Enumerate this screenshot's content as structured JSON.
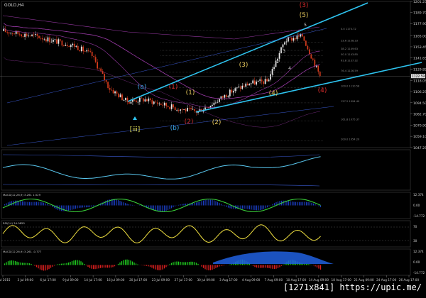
{
  "main": {
    "title": "GOLD,H4",
    "price_ticks": [
      "1201.25",
      "1189.70",
      "1177.90",
      "1165.00",
      "1153.45",
      "1141.65",
      "1129.85",
      "1118.05",
      "1106.25",
      "1094.50",
      "1082.70",
      "1070.90",
      "1059.10",
      "1047.25"
    ],
    "current_price": "1122.59",
    "fib_labels": [
      "0.0 1170.72",
      "23.6 1158.33",
      "38.2 1149.63",
      "50.0 1143.85",
      "61.8 1137.32",
      "76.4 1126.59",
      "100.0 1110.58",
      "127.2 1094.40",
      "161.8 1075.37",
      "200.0 1054.20"
    ],
    "wave_labels": [
      {
        "text": "[iii]",
        "color": "#e6e35c"
      },
      {
        "text": "(a)",
        "color": "#3aa0e0"
      },
      {
        "text": "(b)",
        "color": "#3aa0e0"
      },
      {
        "text": "(1)",
        "color": "#e6c85c"
      },
      {
        "text": "(2)",
        "color": "#e6c85c"
      },
      {
        "text": "(3)",
        "color": "#e6c85c"
      },
      {
        "text": "(4)",
        "color": "#e6c85c"
      },
      {
        "text": "(5)",
        "color": "#e6c85c"
      },
      {
        "text": "(1)",
        "color": "#d62b2b"
      },
      {
        "text": "(2)",
        "color": "#d62b2b"
      },
      {
        "text": "(3)",
        "color": "#d62b2b"
      },
      {
        "text": "(4)",
        "color": "#d62b2b"
      },
      {
        "text": "1",
        "color": "#d9d9d9"
      },
      {
        "text": "2",
        "color": "#d9d9d9"
      },
      {
        "text": "3",
        "color": "#d9d9d9"
      },
      {
        "text": "4",
        "color": "#d9d9d9"
      },
      {
        "text": "5",
        "color": "#d9d9d9"
      }
    ]
  },
  "panels": [
    {
      "label": "",
      "ticks": []
    },
    {
      "label": "MACD(12,26,9) 3.261 1.529",
      "ticks": [
        "12.374",
        "0.00",
        "-14.772"
      ]
    },
    {
      "label": "RSI(14) 34.0855",
      "ticks": [
        "70",
        "30"
      ]
    },
    {
      "label": "MACD(12,26,9) 3.261 -0.777",
      "ticks": [
        "12.374",
        "0.00",
        "-14.772"
      ]
    }
  ],
  "x_ticks": [
    "1 Jul 2015",
    "3 Jul 09:00",
    "6 Jul 17:00",
    "9 Jul 09:00",
    "14 Jul 17:00",
    "16 Jul 09:00",
    "20 Jul 17:00",
    "23 Jul 09:00",
    "27 Jul 17:00",
    "30 Jul 09:00",
    "3 Aug 17:00",
    "4 Aug 09:00",
    "7 Aug 09:00",
    "10 Aug 17:00",
    "14 Aug 09:00",
    "18 Aug 17:00",
    "21 Aug 09:00",
    "24 Aug 17:00",
    "26 Aug 17:00"
  ],
  "colors": {
    "background": "#000000",
    "grid": "#2a2a2a",
    "bull": "#e8e8e8",
    "bear": "#d23a1c",
    "trend": "#2ec4f0",
    "ma_purple": "#9b3aa8",
    "ma_blue": "#3a5ad0",
    "fib": "#555555",
    "axis_text": "#cfcfcf",
    "macd_hist": "#1a3dbf",
    "macd_line": "#3ad03a",
    "rsi_line": "#f0e040",
    "osc_red": "#e02020",
    "osc_green": "#20d020",
    "osc_blue": "#2060e0"
  },
  "watermark": "[1271x841] https://upic.me/",
  "chart_data": {
    "type": "candlestick",
    "title": "GOLD,H4",
    "symbol": "GOLD",
    "timeframe": "H4",
    "y_range": [
      1047.25,
      1201.25
    ],
    "x_range": [
      "1 Jul 2015",
      "26 Aug 17:00"
    ],
    "close_path": [
      {
        "date": "1 Jul",
        "value": 1170
      },
      {
        "date": "3 Jul",
        "value": 1167
      },
      {
        "date": "6 Jul",
        "value": 1164
      },
      {
        "date": "9 Jul",
        "value": 1159
      },
      {
        "date": "14 Jul",
        "value": 1155
      },
      {
        "date": "16 Jul",
        "value": 1145
      },
      {
        "date": "20 Jul",
        "value": 1110
      },
      {
        "date": "23 Jul",
        "value": 1096
      },
      {
        "date": "27 Jul",
        "value": 1098
      },
      {
        "date": "30 Jul",
        "value": 1093
      },
      {
        "date": "3 Aug",
        "value": 1088
      },
      {
        "date": "4 Aug",
        "value": 1085
      },
      {
        "date": "7 Aug",
        "value": 1095
      },
      {
        "date": "10 Aug",
        "value": 1107
      },
      {
        "date": "14 Aug",
        "value": 1115
      },
      {
        "date": "18 Aug",
        "value": 1117
      },
      {
        "date": "21 Aug",
        "value": 1160
      },
      {
        "date": "24 Aug",
        "value": 1165
      },
      {
        "date": "26 Aug",
        "value": 1122.59
      }
    ]
  }
}
